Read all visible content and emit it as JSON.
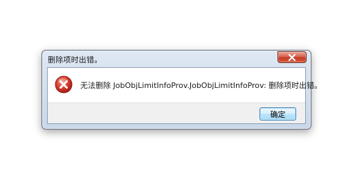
{
  "dialog": {
    "title": "删除项时出错。",
    "message": "无法删除 JobObjLimitInfoProv.JobObjLimitInfoProv: 删除项时出错。",
    "ok_label": "确定",
    "icons": {
      "error": "error-icon",
      "close": "close-icon"
    },
    "colors": {
      "close_button": "#c43a25",
      "error_icon": "#d43a2c",
      "ok_button_border": "#3c7fb1"
    }
  }
}
